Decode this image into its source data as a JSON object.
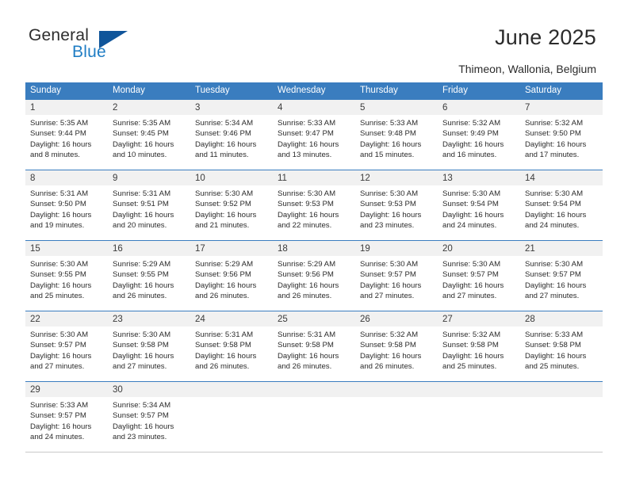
{
  "brand": {
    "name_part1": "General",
    "name_part2": "Blue",
    "flag_icon": "triangle-flag-icon"
  },
  "header": {
    "title": "June 2025",
    "location": "Thimeon, Wallonia, Belgium"
  },
  "colors": {
    "header_blue": "#3a7dbf",
    "brand_blue": "#1f7dc4",
    "flag_blue": "#10559a",
    "date_strip": "#f1f1f1"
  },
  "weekdays": [
    "Sunday",
    "Monday",
    "Tuesday",
    "Wednesday",
    "Thursday",
    "Friday",
    "Saturday"
  ],
  "weeks": [
    {
      "days": [
        {
          "num": "1",
          "sunrise": "Sunrise: 5:35 AM",
          "sunset": "Sunset: 9:44 PM",
          "daylight_1": "Daylight: 16 hours",
          "daylight_2": "and 8 minutes."
        },
        {
          "num": "2",
          "sunrise": "Sunrise: 5:35 AM",
          "sunset": "Sunset: 9:45 PM",
          "daylight_1": "Daylight: 16 hours",
          "daylight_2": "and 10 minutes."
        },
        {
          "num": "3",
          "sunrise": "Sunrise: 5:34 AM",
          "sunset": "Sunset: 9:46 PM",
          "daylight_1": "Daylight: 16 hours",
          "daylight_2": "and 11 minutes."
        },
        {
          "num": "4",
          "sunrise": "Sunrise: 5:33 AM",
          "sunset": "Sunset: 9:47 PM",
          "daylight_1": "Daylight: 16 hours",
          "daylight_2": "and 13 minutes."
        },
        {
          "num": "5",
          "sunrise": "Sunrise: 5:33 AM",
          "sunset": "Sunset: 9:48 PM",
          "daylight_1": "Daylight: 16 hours",
          "daylight_2": "and 15 minutes."
        },
        {
          "num": "6",
          "sunrise": "Sunrise: 5:32 AM",
          "sunset": "Sunset: 9:49 PM",
          "daylight_1": "Daylight: 16 hours",
          "daylight_2": "and 16 minutes."
        },
        {
          "num": "7",
          "sunrise": "Sunrise: 5:32 AM",
          "sunset": "Sunset: 9:50 PM",
          "daylight_1": "Daylight: 16 hours",
          "daylight_2": "and 17 minutes."
        }
      ]
    },
    {
      "days": [
        {
          "num": "8",
          "sunrise": "Sunrise: 5:31 AM",
          "sunset": "Sunset: 9:50 PM",
          "daylight_1": "Daylight: 16 hours",
          "daylight_2": "and 19 minutes."
        },
        {
          "num": "9",
          "sunrise": "Sunrise: 5:31 AM",
          "sunset": "Sunset: 9:51 PM",
          "daylight_1": "Daylight: 16 hours",
          "daylight_2": "and 20 minutes."
        },
        {
          "num": "10",
          "sunrise": "Sunrise: 5:30 AM",
          "sunset": "Sunset: 9:52 PM",
          "daylight_1": "Daylight: 16 hours",
          "daylight_2": "and 21 minutes."
        },
        {
          "num": "11",
          "sunrise": "Sunrise: 5:30 AM",
          "sunset": "Sunset: 9:53 PM",
          "daylight_1": "Daylight: 16 hours",
          "daylight_2": "and 22 minutes."
        },
        {
          "num": "12",
          "sunrise": "Sunrise: 5:30 AM",
          "sunset": "Sunset: 9:53 PM",
          "daylight_1": "Daylight: 16 hours",
          "daylight_2": "and 23 minutes."
        },
        {
          "num": "13",
          "sunrise": "Sunrise: 5:30 AM",
          "sunset": "Sunset: 9:54 PM",
          "daylight_1": "Daylight: 16 hours",
          "daylight_2": "and 24 minutes."
        },
        {
          "num": "14",
          "sunrise": "Sunrise: 5:30 AM",
          "sunset": "Sunset: 9:54 PM",
          "daylight_1": "Daylight: 16 hours",
          "daylight_2": "and 24 minutes."
        }
      ]
    },
    {
      "days": [
        {
          "num": "15",
          "sunrise": "Sunrise: 5:30 AM",
          "sunset": "Sunset: 9:55 PM",
          "daylight_1": "Daylight: 16 hours",
          "daylight_2": "and 25 minutes."
        },
        {
          "num": "16",
          "sunrise": "Sunrise: 5:29 AM",
          "sunset": "Sunset: 9:55 PM",
          "daylight_1": "Daylight: 16 hours",
          "daylight_2": "and 26 minutes."
        },
        {
          "num": "17",
          "sunrise": "Sunrise: 5:29 AM",
          "sunset": "Sunset: 9:56 PM",
          "daylight_1": "Daylight: 16 hours",
          "daylight_2": "and 26 minutes."
        },
        {
          "num": "18",
          "sunrise": "Sunrise: 5:29 AM",
          "sunset": "Sunset: 9:56 PM",
          "daylight_1": "Daylight: 16 hours",
          "daylight_2": "and 26 minutes."
        },
        {
          "num": "19",
          "sunrise": "Sunrise: 5:30 AM",
          "sunset": "Sunset: 9:57 PM",
          "daylight_1": "Daylight: 16 hours",
          "daylight_2": "and 27 minutes."
        },
        {
          "num": "20",
          "sunrise": "Sunrise: 5:30 AM",
          "sunset": "Sunset: 9:57 PM",
          "daylight_1": "Daylight: 16 hours",
          "daylight_2": "and 27 minutes."
        },
        {
          "num": "21",
          "sunrise": "Sunrise: 5:30 AM",
          "sunset": "Sunset: 9:57 PM",
          "daylight_1": "Daylight: 16 hours",
          "daylight_2": "and 27 minutes."
        }
      ]
    },
    {
      "days": [
        {
          "num": "22",
          "sunrise": "Sunrise: 5:30 AM",
          "sunset": "Sunset: 9:57 PM",
          "daylight_1": "Daylight: 16 hours",
          "daylight_2": "and 27 minutes."
        },
        {
          "num": "23",
          "sunrise": "Sunrise: 5:30 AM",
          "sunset": "Sunset: 9:58 PM",
          "daylight_1": "Daylight: 16 hours",
          "daylight_2": "and 27 minutes."
        },
        {
          "num": "24",
          "sunrise": "Sunrise: 5:31 AM",
          "sunset": "Sunset: 9:58 PM",
          "daylight_1": "Daylight: 16 hours",
          "daylight_2": "and 26 minutes."
        },
        {
          "num": "25",
          "sunrise": "Sunrise: 5:31 AM",
          "sunset": "Sunset: 9:58 PM",
          "daylight_1": "Daylight: 16 hours",
          "daylight_2": "and 26 minutes."
        },
        {
          "num": "26",
          "sunrise": "Sunrise: 5:32 AM",
          "sunset": "Sunset: 9:58 PM",
          "daylight_1": "Daylight: 16 hours",
          "daylight_2": "and 26 minutes."
        },
        {
          "num": "27",
          "sunrise": "Sunrise: 5:32 AM",
          "sunset": "Sunset: 9:58 PM",
          "daylight_1": "Daylight: 16 hours",
          "daylight_2": "and 25 minutes."
        },
        {
          "num": "28",
          "sunrise": "Sunrise: 5:33 AM",
          "sunset": "Sunset: 9:58 PM",
          "daylight_1": "Daylight: 16 hours",
          "daylight_2": "and 25 minutes."
        }
      ]
    },
    {
      "days": [
        {
          "num": "29",
          "sunrise": "Sunrise: 5:33 AM",
          "sunset": "Sunset: 9:57 PM",
          "daylight_1": "Daylight: 16 hours",
          "daylight_2": "and 24 minutes."
        },
        {
          "num": "30",
          "sunrise": "Sunrise: 5:34 AM",
          "sunset": "Sunset: 9:57 PM",
          "daylight_1": "Daylight: 16 hours",
          "daylight_2": "and 23 minutes."
        },
        {
          "num": "",
          "sunrise": "",
          "sunset": "",
          "daylight_1": "",
          "daylight_2": ""
        },
        {
          "num": "",
          "sunrise": "",
          "sunset": "",
          "daylight_1": "",
          "daylight_2": ""
        },
        {
          "num": "",
          "sunrise": "",
          "sunset": "",
          "daylight_1": "",
          "daylight_2": ""
        },
        {
          "num": "",
          "sunrise": "",
          "sunset": "",
          "daylight_1": "",
          "daylight_2": ""
        },
        {
          "num": "",
          "sunrise": "",
          "sunset": "",
          "daylight_1": "",
          "daylight_2": ""
        }
      ]
    }
  ]
}
